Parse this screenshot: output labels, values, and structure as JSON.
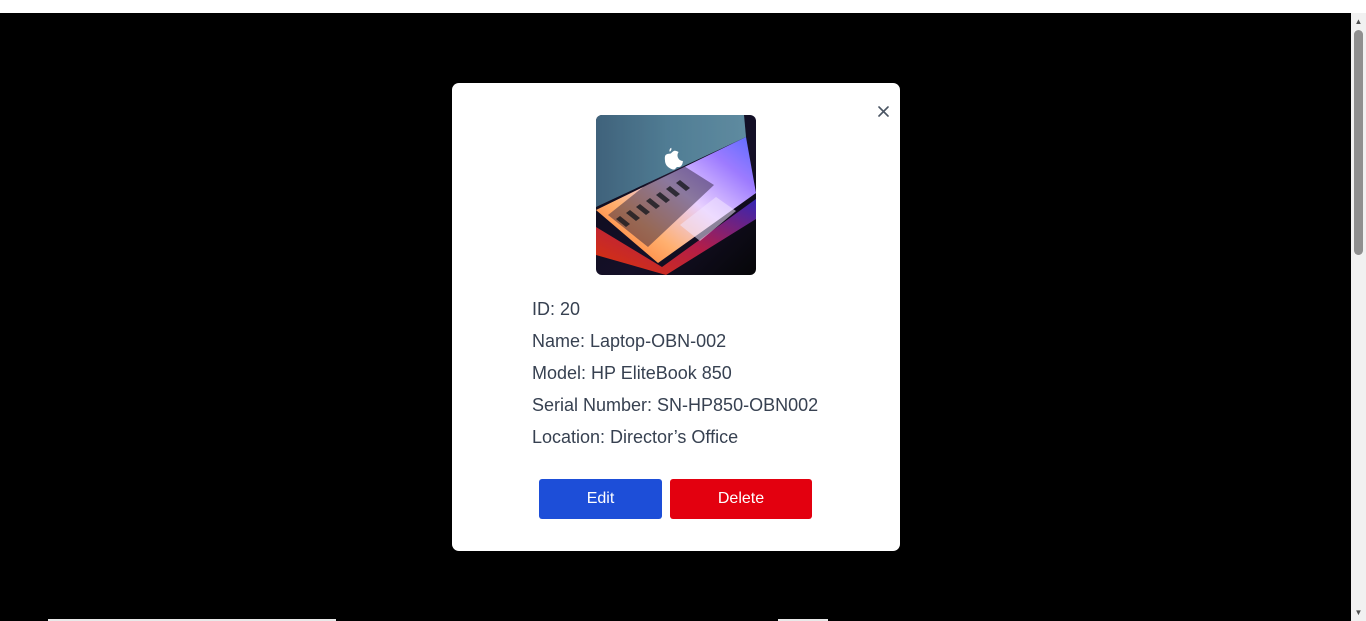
{
  "modal": {
    "image_alt": "laptop",
    "id_line": "ID: 20",
    "name_line": "Name: Laptop-OBN-002",
    "model_line": "Model: HP EliteBook 850",
    "serial_line": "Serial Number: SN-HP850-OBN002",
    "location_line": "Location: Director’s Office",
    "close_icon": "close-icon",
    "edit_label": "Edit",
    "delete_label": "Delete"
  },
  "colors": {
    "overlay": "#000000",
    "edit_button": "#1d4ed8",
    "delete_button": "#e3000f",
    "text": "#374151"
  }
}
